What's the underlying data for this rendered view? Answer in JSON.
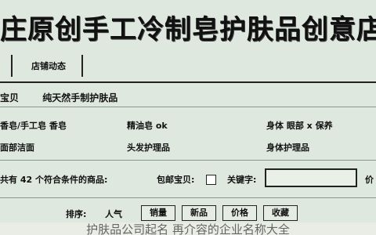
{
  "shop": {
    "title": "庄原创手工冷制皂护肤品创意店"
  },
  "tabs": [
    {
      "label": ""
    },
    {
      "label": "店铺动态"
    }
  ],
  "breadcrumb": {
    "item1": "宝贝",
    "item2": "纯天然手制护肤品"
  },
  "categories": [
    "香皂/手工皂 香皂",
    "精油皂 ok",
    "身体 眼部 x 保养",
    "面部洁面",
    "头发护理品",
    "身体护理品"
  ],
  "filters": {
    "result_count": "共有 42 个符合条件的商品:",
    "free_shipping_label": "包邮宝贝:",
    "keyword_label": "关键字:",
    "keyword_value": "",
    "price_label": "价"
  },
  "sort": {
    "label": "排序:",
    "popularity": "人气",
    "options": [
      "销量",
      "新品",
      "价格",
      "收藏"
    ]
  },
  "overlay": {
    "text": "护肤品公司起名 再介容的企业名称大全"
  },
  "colors": {
    "background": "#dfe8df",
    "border": "#222222"
  }
}
